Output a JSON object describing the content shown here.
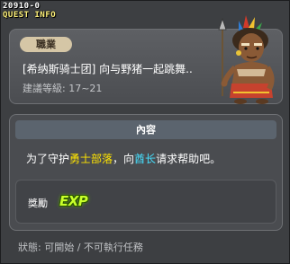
{
  "window": {
    "quest_id": "20910-0",
    "title": "QUEST INFO"
  },
  "npc": {
    "job_label": "職業",
    "name": "[希纳斯骑士团] 向与野猪一起跳舞..",
    "level": "建議等級: 17~21"
  },
  "content": {
    "header": "內容",
    "description_parts": [
      "为了守护",
      "勇士部落",
      "，向",
      "酋长",
      "请求帮助吧。"
    ]
  },
  "reward": {
    "label": "獎勵",
    "exp_label": "EXP"
  },
  "status": {
    "text": "狀態: 可開始 / 不可執行任務"
  },
  "colors": {
    "highlight_location": "#ffe400",
    "highlight_npc": "#46e0ff",
    "title": "#fff27a",
    "exp": "#c8ff2a"
  }
}
